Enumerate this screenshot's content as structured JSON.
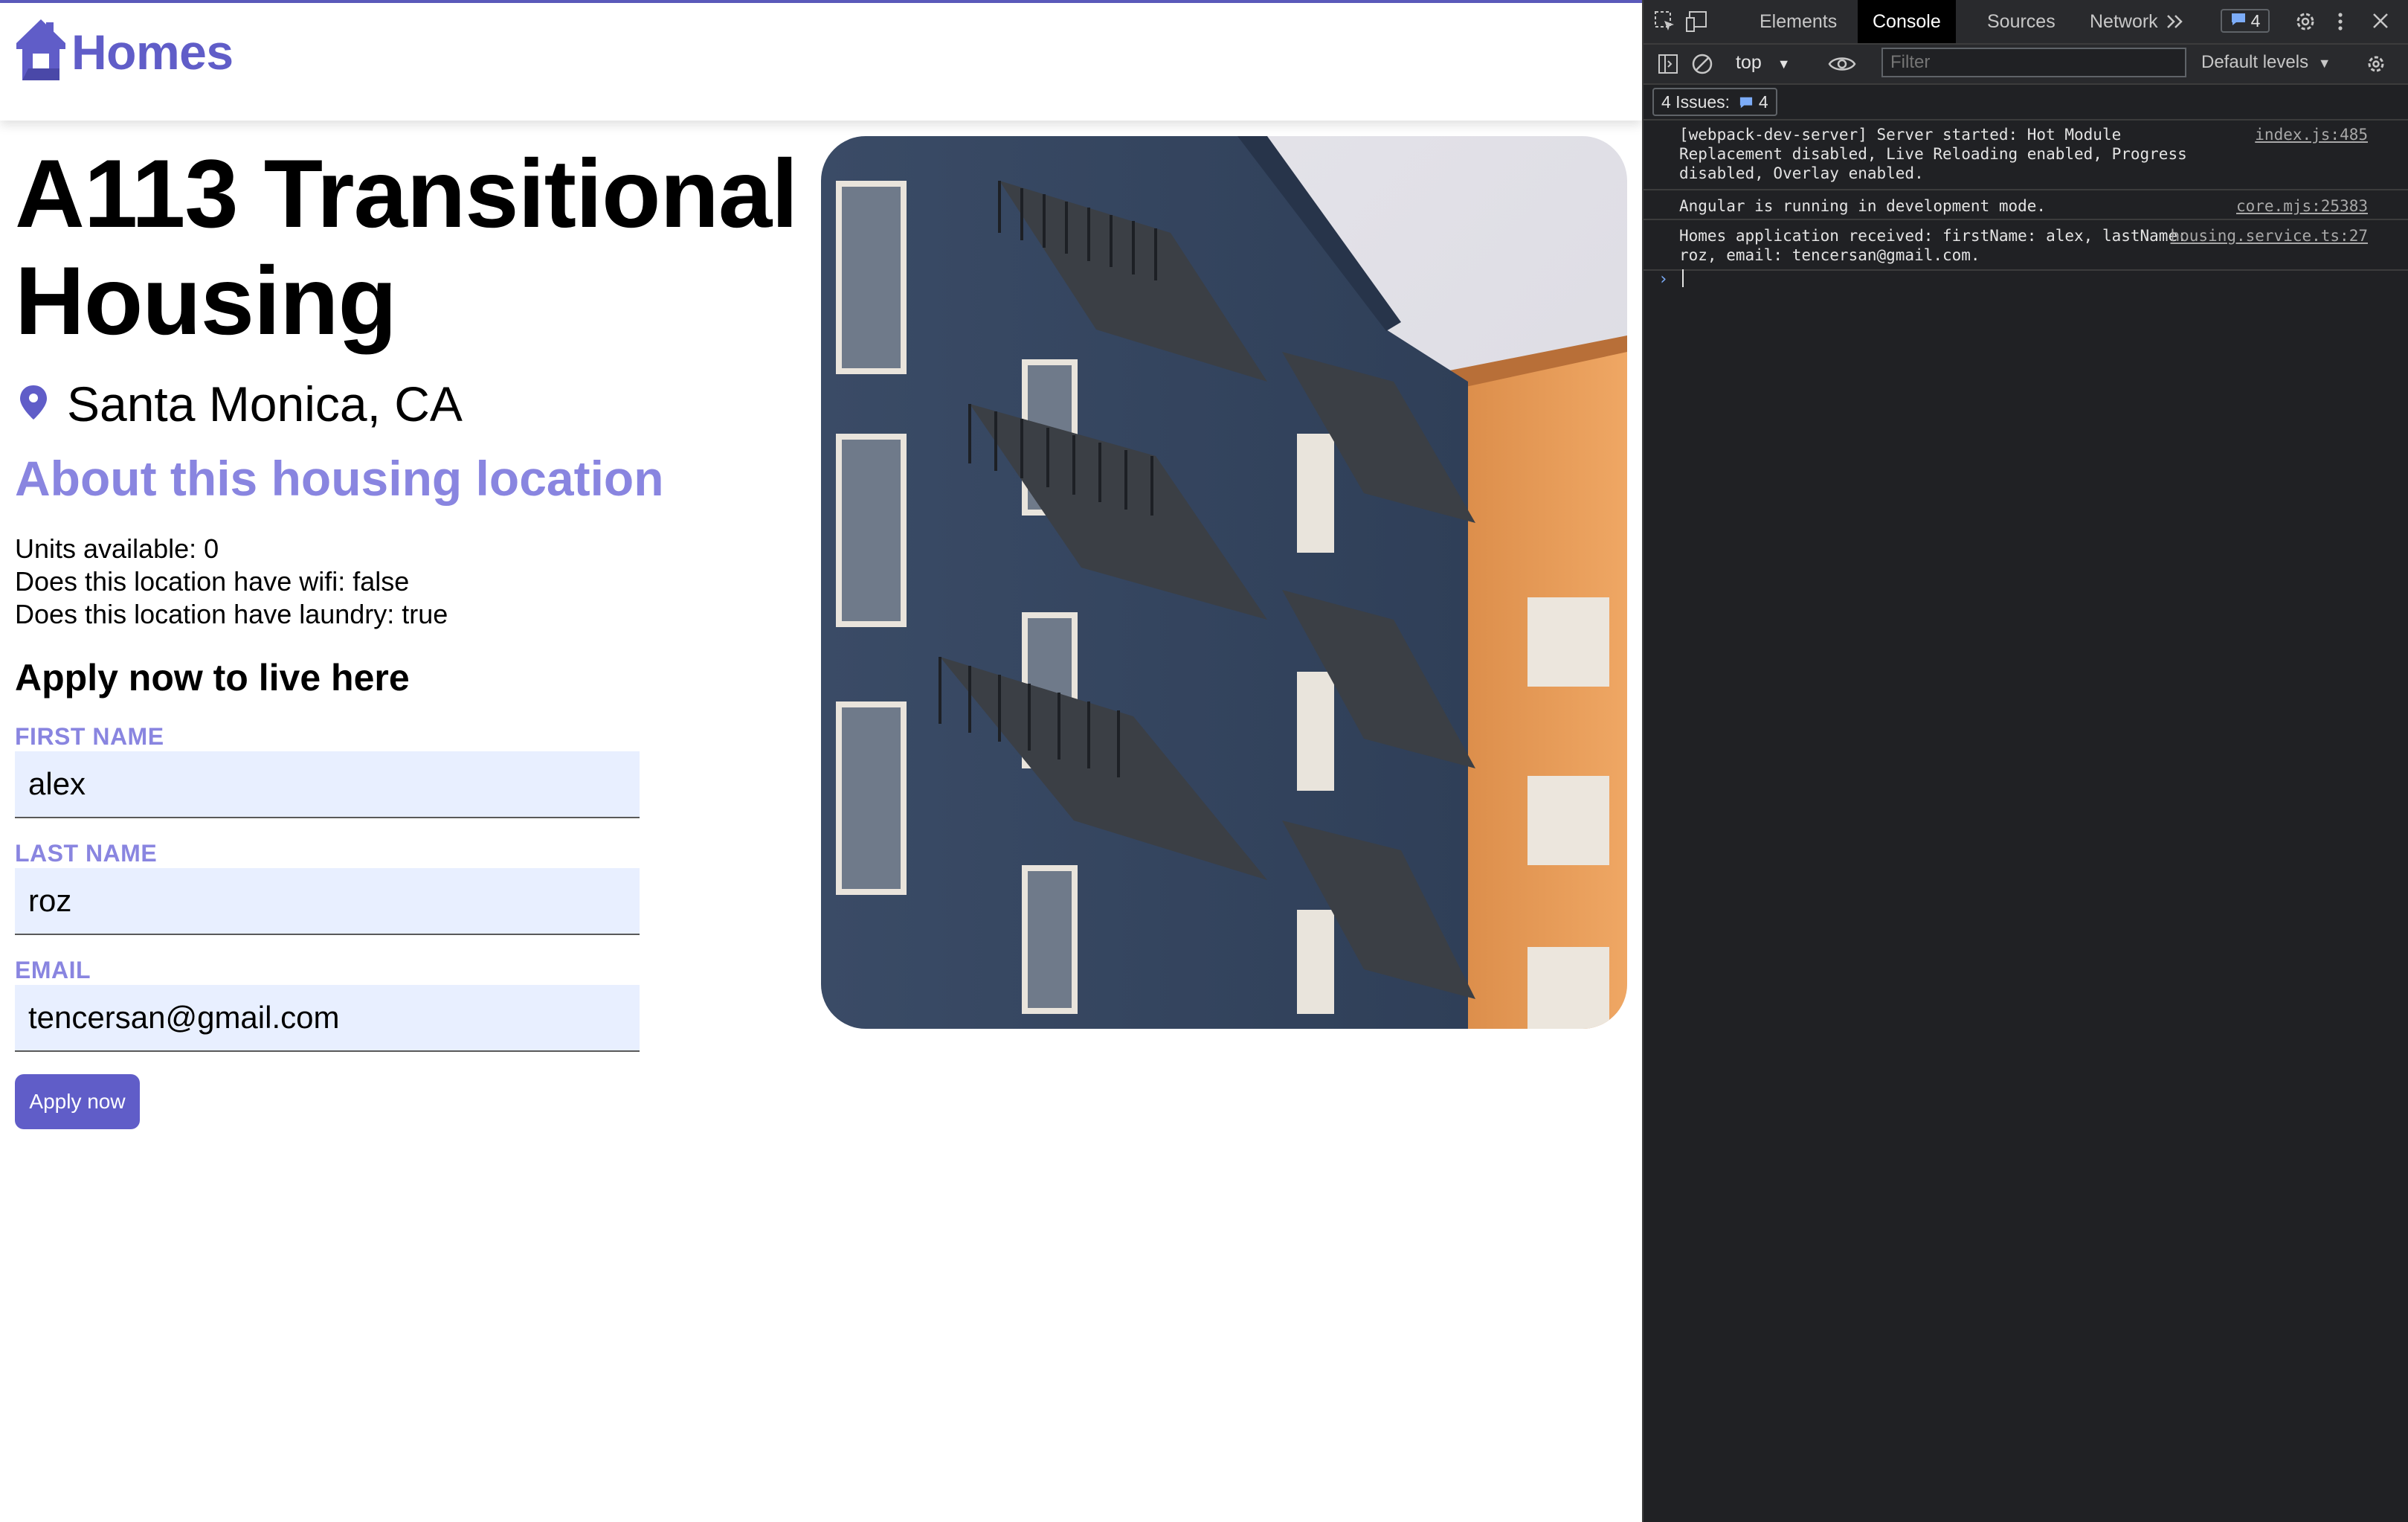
{
  "app": {
    "brand": "Homes",
    "accent_color": "#605dc8",
    "label_color": "#8985e0"
  },
  "listing": {
    "title": "A113 Transitional Housing",
    "location": "Santa Monica, CA",
    "about_heading": "About this housing location",
    "features": [
      "Units available: 0",
      "Does this location have wifi: false",
      "Does this location have laundry: true"
    ],
    "photo_icon": "apartment-building-photo"
  },
  "form": {
    "heading": "Apply now to live here",
    "first_name": {
      "label": "FIRST NAME",
      "value": "alex"
    },
    "last_name": {
      "label": "LAST NAME",
      "value": "roz"
    },
    "email": {
      "label": "EMAIL",
      "value": "tencersan@gmail.com"
    },
    "submit_label": "Apply now"
  },
  "devtools": {
    "tabs": [
      "Elements",
      "Console",
      "Sources",
      "Network"
    ],
    "active_tab": "Console",
    "issues_badge": "4",
    "context": "top",
    "filter_placeholder": "Filter",
    "levels": "Default levels",
    "issues_label": "4 Issues:",
    "issues_count": "4",
    "messages": [
      {
        "text": "[webpack-dev-server] Server started: Hot Module Replacement disabled, Live Reloading enabled, Progress disabled, Overlay enabled.",
        "source": "index.js:485"
      },
      {
        "text": "Angular is running in development mode.",
        "source": "core.mjs:25383"
      },
      {
        "text": "Homes application received: firstName: alex, lastName: roz, email: tencersan@gmail.com.",
        "source": "housing.service.ts:27"
      }
    ]
  }
}
